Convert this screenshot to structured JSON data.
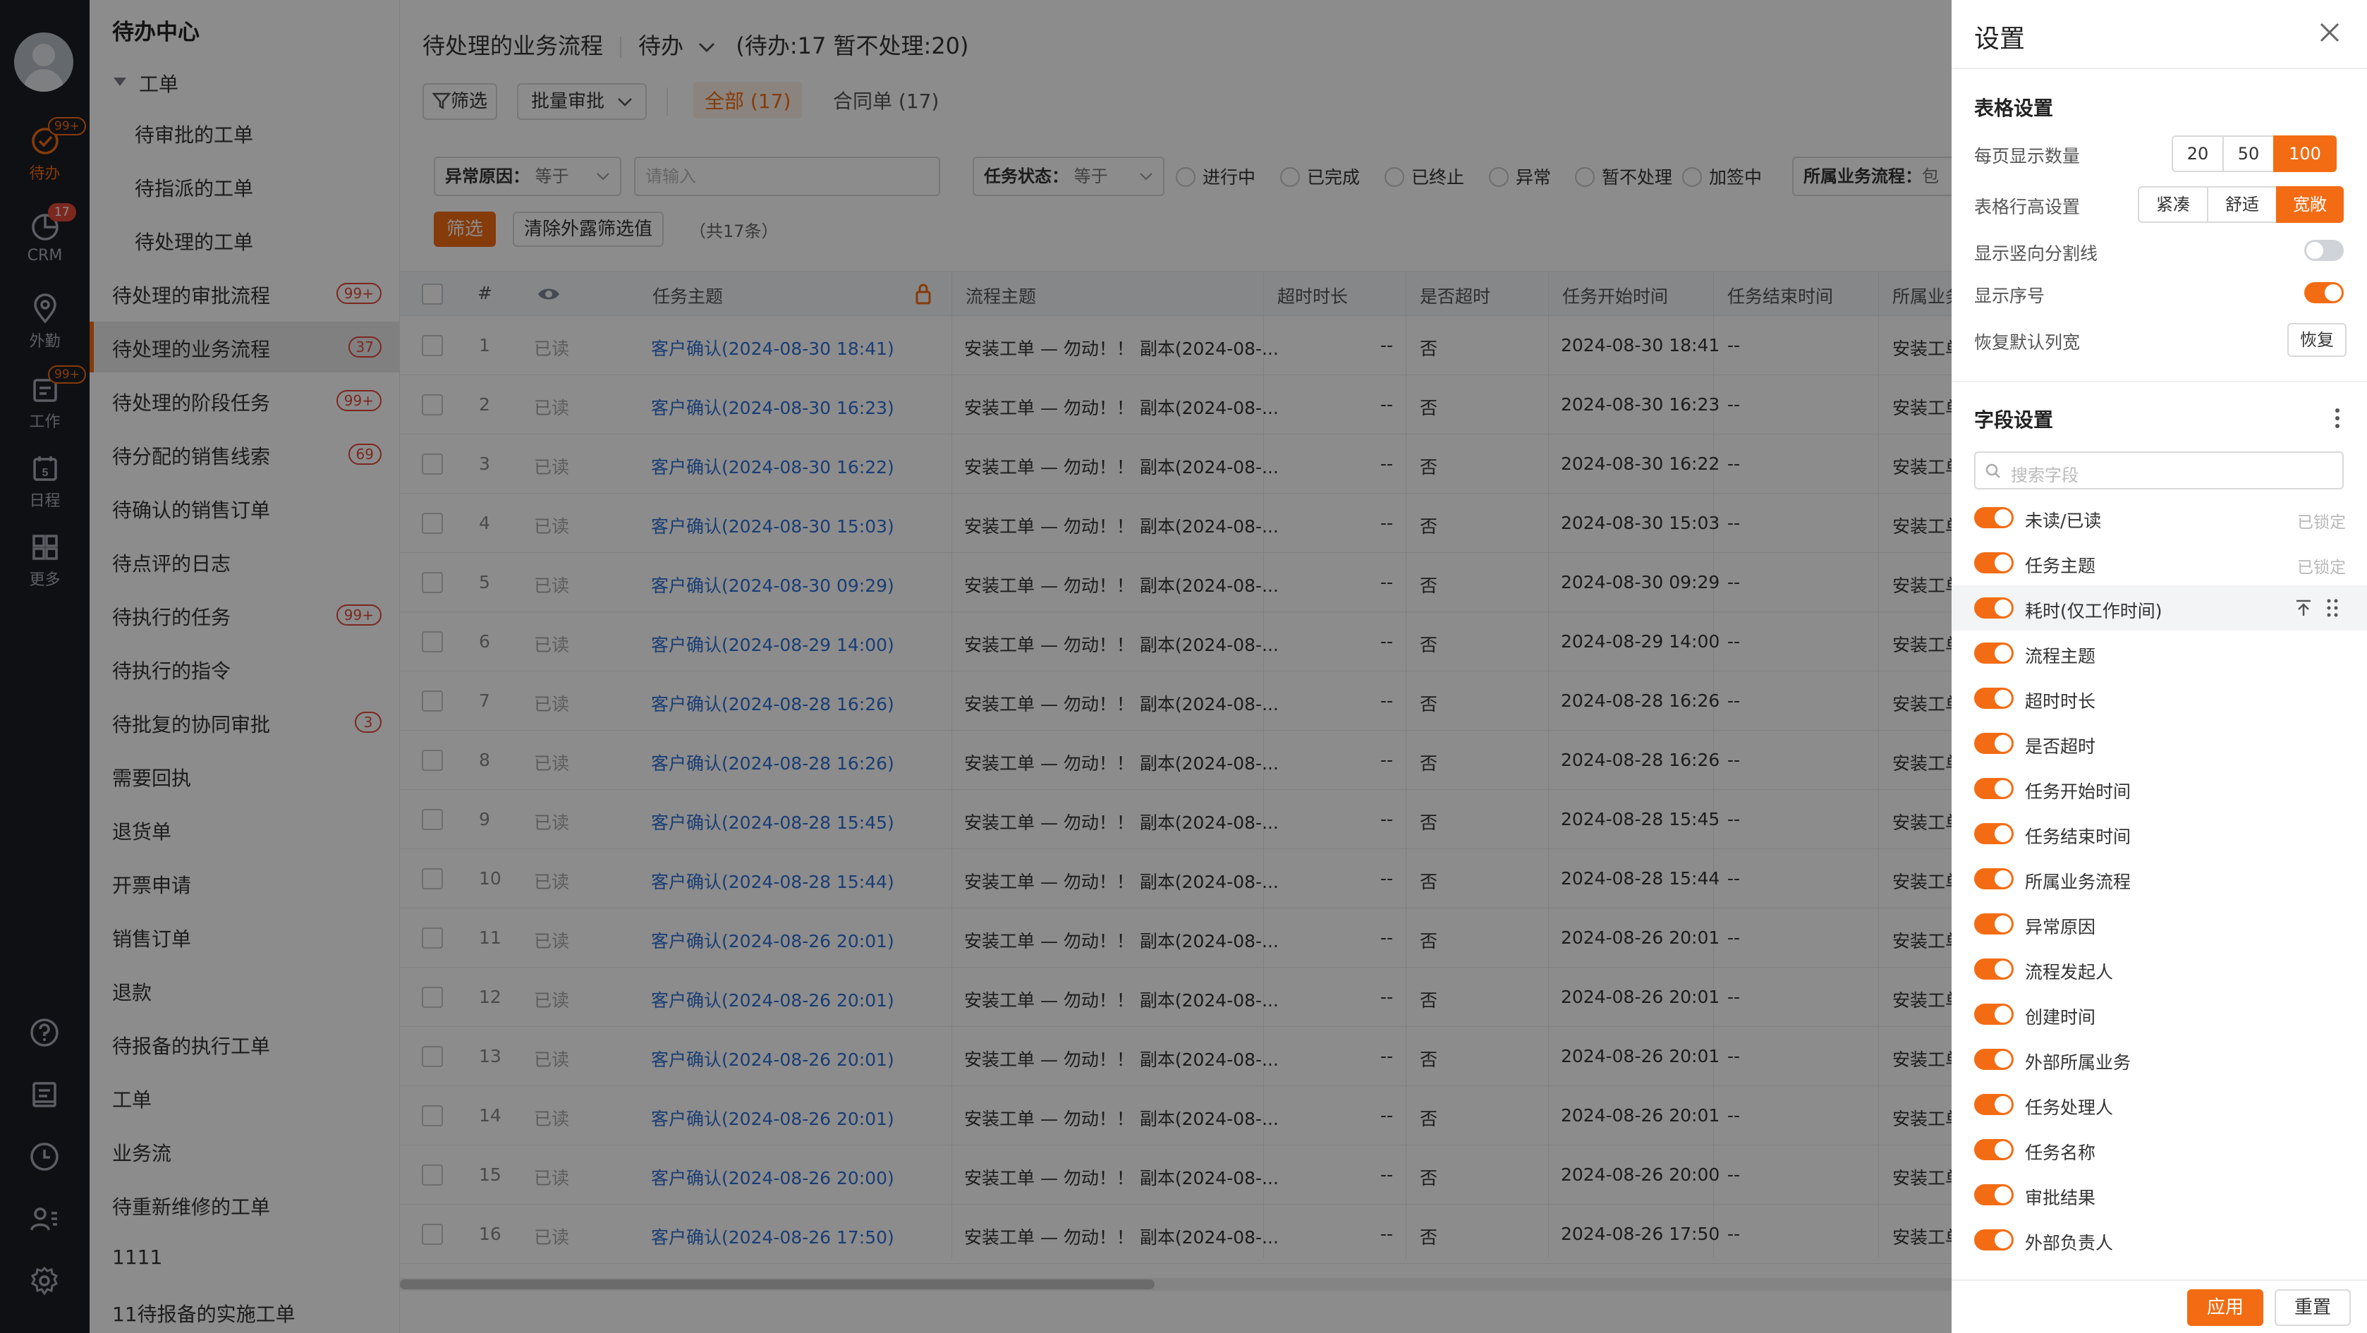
{
  "rail": {
    "items": [
      {
        "label": "待办",
        "badge": "99+",
        "icon": "check-circle-icon",
        "active": true
      },
      {
        "label": "CRM",
        "badge": "17",
        "icon": "pie-chart-icon",
        "active": false
      },
      {
        "label": "外勤",
        "badge": "",
        "icon": "location-icon",
        "active": false
      },
      {
        "label": "工作",
        "badge": "99+",
        "icon": "work-icon",
        "active": false
      },
      {
        "label": "日程",
        "badge": "",
        "day": "5",
        "icon": "calendar-icon",
        "active": false
      },
      {
        "label": "更多",
        "badge": "",
        "icon": "grid-icon",
        "active": false
      }
    ],
    "bottom_icons": [
      "help-icon",
      "note-icon",
      "clock-icon",
      "contacts-icon",
      "settings-icon"
    ]
  },
  "sidebar": {
    "title": "待办中心",
    "group": "工单",
    "items": [
      {
        "label": "待审批的工单",
        "badge": "",
        "sub": true
      },
      {
        "label": "待指派的工单",
        "badge": "",
        "sub": true
      },
      {
        "label": "待处理的工单",
        "badge": "",
        "sub": true
      },
      {
        "label": "待处理的审批流程",
        "badge": "99+",
        "sub": false
      },
      {
        "label": "待处理的业务流程",
        "badge": "37",
        "sub": false,
        "active": true
      },
      {
        "label": "待处理的阶段任务",
        "badge": "99+",
        "sub": false
      },
      {
        "label": "待分配的销售线索",
        "badge": "69",
        "sub": false
      },
      {
        "label": "待确认的销售订单",
        "badge": "",
        "sub": false
      },
      {
        "label": "待点评的日志",
        "badge": "",
        "sub": false
      },
      {
        "label": "待执行的任务",
        "badge": "99+",
        "sub": false
      },
      {
        "label": "待执行的指令",
        "badge": "",
        "sub": false
      },
      {
        "label": "待批复的协同审批",
        "badge": "3",
        "sub": false
      },
      {
        "label": "需要回执",
        "badge": "",
        "sub": false
      },
      {
        "label": "退货单",
        "badge": "",
        "sub": false
      },
      {
        "label": "开票申请",
        "badge": "",
        "sub": false
      },
      {
        "label": "销售订单",
        "badge": "",
        "sub": false
      },
      {
        "label": "退款",
        "badge": "",
        "sub": false
      },
      {
        "label": "待报备的执行工单",
        "badge": "",
        "sub": false
      },
      {
        "label": "工单",
        "badge": "",
        "sub": false
      },
      {
        "label": "业务流",
        "badge": "",
        "sub": false
      },
      {
        "label": "待重新维修的工单",
        "badge": "",
        "sub": false
      },
      {
        "label": "1111",
        "badge": "",
        "sub": false
      },
      {
        "label": "11待报备的实施工单",
        "badge": "",
        "sub": false
      }
    ]
  },
  "main": {
    "title": "待处理的业务流程",
    "view": "待办",
    "counts": "(待办:17 暂不处理:20)",
    "filter_button": "筛选",
    "batch_button": "批量审批",
    "tab_all": "全部 (17)",
    "tab_contract": "合同单 (17)",
    "filters": {
      "reason_label": "异常原因：",
      "reason_op": "等于",
      "input_placeholder": "请输入",
      "status_label": "任务状态：",
      "status_op": "等于",
      "status_options": [
        "进行中",
        "已完成",
        "已终止",
        "异常",
        "暂不处理",
        "加签中"
      ],
      "process_label": "所属业务流程：",
      "process_value": "包",
      "apply_button": "筛选",
      "clear_button": "清除外露筛选值",
      "total": "（共17条）"
    },
    "columns": [
      "#",
      "任务主题",
      "流程主题",
      "超时时长",
      "是否超时",
      "任务开始时间",
      "任务结束时间",
      "所属业务"
    ],
    "rows": [
      {
        "n": "1",
        "read": "已读",
        "task": "客户确认(2024-08-30 18:41)",
        "flow": "安装工单 — 勿动！！ 副本(2024-08-...",
        "overtime": "--",
        "is_over": "否",
        "start": "2024-08-30 18:41",
        "end": "--",
        "biz": "安装工单"
      },
      {
        "n": "2",
        "read": "已读",
        "task": "客户确认(2024-08-30 16:23)",
        "flow": "安装工单 — 勿动！！ 副本(2024-08-...",
        "overtime": "--",
        "is_over": "否",
        "start": "2024-08-30 16:23",
        "end": "--",
        "biz": "安装工单"
      },
      {
        "n": "3",
        "read": "已读",
        "task": "客户确认(2024-08-30 16:22)",
        "flow": "安装工单 — 勿动！！ 副本(2024-08-...",
        "overtime": "--",
        "is_over": "否",
        "start": "2024-08-30 16:22",
        "end": "--",
        "biz": "安装工单"
      },
      {
        "n": "4",
        "read": "已读",
        "task": "客户确认(2024-08-30 15:03)",
        "flow": "安装工单 — 勿动！！ 副本(2024-08-...",
        "overtime": "--",
        "is_over": "否",
        "start": "2024-08-30 15:03",
        "end": "--",
        "biz": "安装工单"
      },
      {
        "n": "5",
        "read": "已读",
        "task": "客户确认(2024-08-30 09:29)",
        "flow": "安装工单 — 勿动！！ 副本(2024-08-...",
        "overtime": "--",
        "is_over": "否",
        "start": "2024-08-30 09:29",
        "end": "--",
        "biz": "安装工单"
      },
      {
        "n": "6",
        "read": "已读",
        "task": "客户确认(2024-08-29 14:00)",
        "flow": "安装工单 — 勿动！！ 副本(2024-08-...",
        "overtime": "--",
        "is_over": "否",
        "start": "2024-08-29 14:00",
        "end": "--",
        "biz": "安装工单"
      },
      {
        "n": "7",
        "read": "已读",
        "task": "客户确认(2024-08-28 16:26)",
        "flow": "安装工单 — 勿动！！ 副本(2024-08-...",
        "overtime": "--",
        "is_over": "否",
        "start": "2024-08-28 16:26",
        "end": "--",
        "biz": "安装工单"
      },
      {
        "n": "8",
        "read": "已读",
        "task": "客户确认(2024-08-28 16:26)",
        "flow": "安装工单 — 勿动！！ 副本(2024-08-...",
        "overtime": "--",
        "is_over": "否",
        "start": "2024-08-28 16:26",
        "end": "--",
        "biz": "安装工单"
      },
      {
        "n": "9",
        "read": "已读",
        "task": "客户确认(2024-08-28 15:45)",
        "flow": "安装工单 — 勿动！！ 副本(2024-08-...",
        "overtime": "--",
        "is_over": "否",
        "start": "2024-08-28 15:45",
        "end": "--",
        "biz": "安装工单"
      },
      {
        "n": "10",
        "read": "已读",
        "task": "客户确认(2024-08-28 15:44)",
        "flow": "安装工单 — 勿动！！ 副本(2024-08-...",
        "overtime": "--",
        "is_over": "否",
        "start": "2024-08-28 15:44",
        "end": "--",
        "biz": "安装工单"
      },
      {
        "n": "11",
        "read": "已读",
        "task": "客户确认(2024-08-26 20:01)",
        "flow": "安装工单 — 勿动！！ 副本(2024-08-...",
        "overtime": "--",
        "is_over": "否",
        "start": "2024-08-26 20:01",
        "end": "--",
        "biz": "安装工单"
      },
      {
        "n": "12",
        "read": "已读",
        "task": "客户确认(2024-08-26 20:01)",
        "flow": "安装工单 — 勿动！！ 副本(2024-08-...",
        "overtime": "--",
        "is_over": "否",
        "start": "2024-08-26 20:01",
        "end": "--",
        "biz": "安装工单"
      },
      {
        "n": "13",
        "read": "已读",
        "task": "客户确认(2024-08-26 20:01)",
        "flow": "安装工单 — 勿动！！ 副本(2024-08-...",
        "overtime": "--",
        "is_over": "否",
        "start": "2024-08-26 20:01",
        "end": "--",
        "biz": "安装工单"
      },
      {
        "n": "14",
        "read": "已读",
        "task": "客户确认(2024-08-26 20:01)",
        "flow": "安装工单 — 勿动！！ 副本(2024-08-...",
        "overtime": "--",
        "is_over": "否",
        "start": "2024-08-26 20:01",
        "end": "--",
        "biz": "安装工单"
      },
      {
        "n": "15",
        "read": "已读",
        "task": "客户确认(2024-08-26 20:00)",
        "flow": "安装工单 — 勿动！！ 副本(2024-08-...",
        "overtime": "--",
        "is_over": "否",
        "start": "2024-08-26 20:00",
        "end": "--",
        "biz": "安装工单"
      },
      {
        "n": "16",
        "read": "已读",
        "task": "客户确认(2024-08-26 17:50)",
        "flow": "安装工单 — 勿动！！ 副本(2024-08-...",
        "overtime": "--",
        "is_over": "否",
        "start": "2024-08-26 17:50",
        "end": "--",
        "biz": "安装工单"
      }
    ]
  },
  "panel": {
    "title": "设置",
    "table_section": "表格设置",
    "page_size_label": "每页显示数量",
    "page_sizes": [
      "20",
      "50",
      "100"
    ],
    "page_size_selected": "100",
    "row_height_label": "表格行高设置",
    "row_heights": [
      "紧凑",
      "舒适",
      "宽敞"
    ],
    "row_height_selected": "宽敞",
    "divider_label": "显示竖向分割线",
    "divider_on": false,
    "serial_label": "显示序号",
    "serial_on": true,
    "reset_width_label": "恢复默认列宽",
    "reset_width_button": "恢复",
    "field_section": "字段设置",
    "field_search_placeholder": "搜索字段",
    "locked_text": "已锁定",
    "fields": [
      {
        "label": "未读/已读",
        "on": true,
        "locked": true
      },
      {
        "label": "任务主题",
        "on": true,
        "locked": true
      },
      {
        "label": "耗时(仅工作时间)",
        "on": true,
        "locked": false,
        "hover": true
      },
      {
        "label": "流程主题",
        "on": true,
        "locked": false
      },
      {
        "label": "超时时长",
        "on": true,
        "locked": false
      },
      {
        "label": "是否超时",
        "on": true,
        "locked": false
      },
      {
        "label": "任务开始时间",
        "on": true,
        "locked": false
      },
      {
        "label": "任务结束时间",
        "on": true,
        "locked": false
      },
      {
        "label": "所属业务流程",
        "on": true,
        "locked": false
      },
      {
        "label": "异常原因",
        "on": true,
        "locked": false
      },
      {
        "label": "流程发起人",
        "on": true,
        "locked": false
      },
      {
        "label": "创建时间",
        "on": true,
        "locked": false
      },
      {
        "label": "外部所属业务",
        "on": true,
        "locked": false
      },
      {
        "label": "任务处理人",
        "on": true,
        "locked": false
      },
      {
        "label": "任务名称",
        "on": true,
        "locked": false
      },
      {
        "label": "审批结果",
        "on": true,
        "locked": false
      },
      {
        "label": "外部负责人",
        "on": true,
        "locked": false
      }
    ],
    "apply_button": "应用",
    "reset_button": "重置"
  },
  "colors": {
    "accent": "#f36c13",
    "link": "#2f6fd6",
    "rail_bg": "#1c1e24",
    "badge_red": "#e24a3a"
  }
}
